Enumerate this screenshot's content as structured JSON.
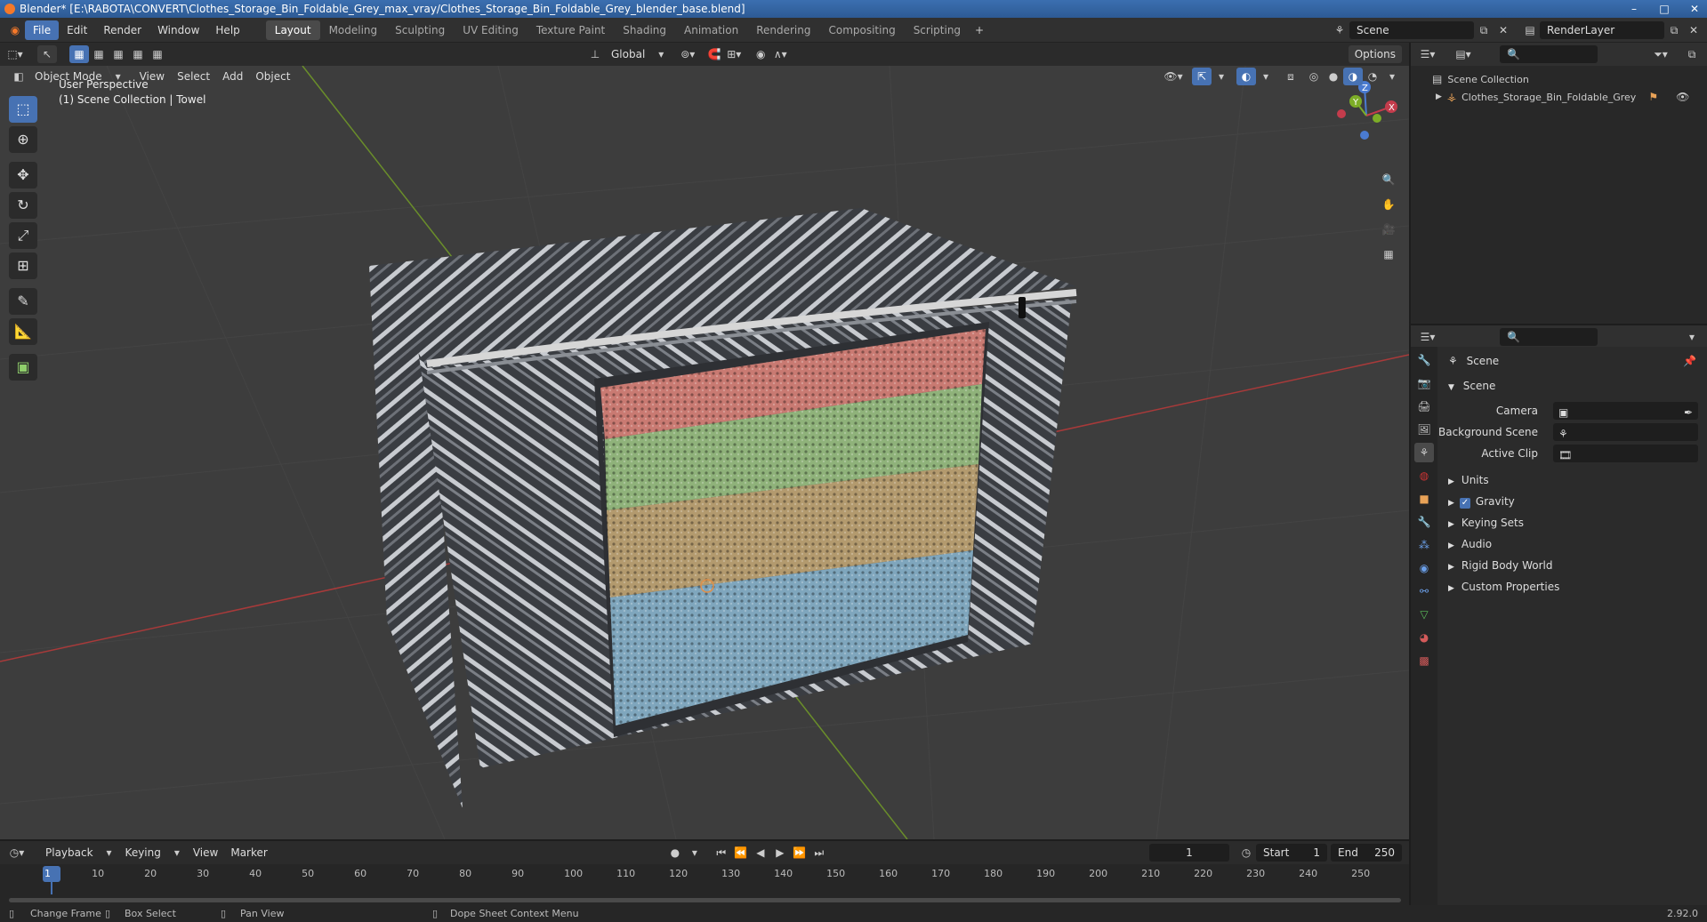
{
  "window": {
    "title": "Blender* [E:\\RABOTA\\CONVERT\\Clothes_Storage_Bin_Foldable_Grey_max_vray/Clothes_Storage_Bin_Foldable_Grey_blender_base.blend]"
  },
  "menu": [
    "File",
    "Edit",
    "Render",
    "Window",
    "Help"
  ],
  "workspaces": [
    "Layout",
    "Modeling",
    "Sculpting",
    "UV Editing",
    "Texture Paint",
    "Shading",
    "Animation",
    "Rendering",
    "Compositing",
    "Scripting"
  ],
  "scene_field": "Scene",
  "render_layer_field": "RenderLayer",
  "viewport": {
    "transform_orientation": "Global",
    "options_label": "Options",
    "mode": "Object Mode",
    "header_menus": [
      "View",
      "Select",
      "Add",
      "Object"
    ],
    "overlay_line1": "User Perspective",
    "overlay_line2": "(1) Scene Collection | Towel",
    "gizmo": {
      "x": "X",
      "y": "Y",
      "z": "Z"
    }
  },
  "outliner": {
    "root": "Scene Collection",
    "items": [
      "Clothes_Storage_Bin_Foldable_Grey"
    ]
  },
  "properties": {
    "context": "Scene",
    "panel": "Scene",
    "fields": [
      {
        "label": "Camera"
      },
      {
        "label": "Background Scene"
      },
      {
        "label": "Active Clip"
      }
    ],
    "sections": [
      "Units",
      "Gravity",
      "Keying Sets",
      "Audio",
      "Rigid Body World",
      "Custom Properties"
    ],
    "gravity_checked": true
  },
  "timeline": {
    "menus": [
      "Playback",
      "Keying",
      "View",
      "Marker"
    ],
    "current_frame": "1",
    "start_label": "Start",
    "start": "1",
    "end_label": "End",
    "end": "250",
    "ticks": [
      "1",
      "10",
      "20",
      "30",
      "40",
      "50",
      "60",
      "70",
      "80",
      "90",
      "100",
      "110",
      "120",
      "130",
      "140",
      "150",
      "160",
      "170",
      "180",
      "190",
      "200",
      "210",
      "220",
      "230",
      "240",
      "250"
    ]
  },
  "statusbar": {
    "items": [
      "Change Frame",
      "Box Select",
      "Pan View",
      "Dope Sheet Context Menu"
    ],
    "version": "2.92.0"
  },
  "colors": {
    "accent": "#4772b3",
    "stripe_red": "#c97a72",
    "stripe_green": "#8fb27a",
    "stripe_tan": "#b39a6e",
    "stripe_blue": "#7fa6bd"
  }
}
